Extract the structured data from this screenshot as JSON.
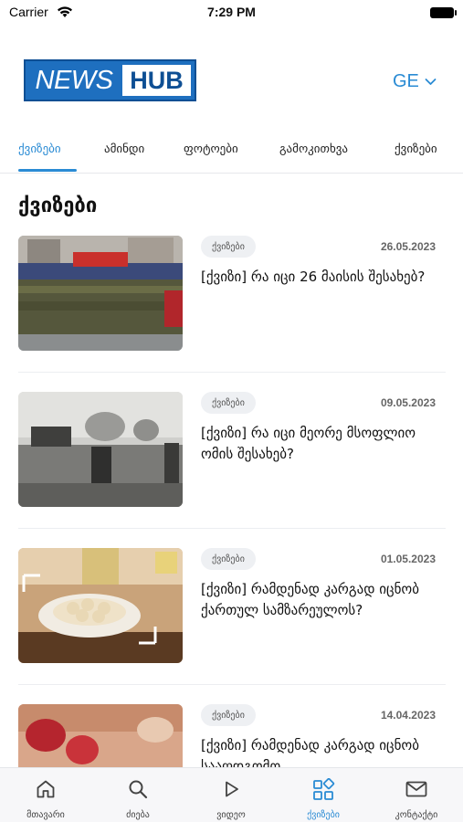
{
  "status_bar": {
    "carrier": "Carrier",
    "time": "7:29 PM"
  },
  "header": {
    "logo_news": "NEWS",
    "logo_hub": "HUB",
    "language": "GE"
  },
  "tabs": [
    {
      "label": "ქვიზები",
      "active": true
    },
    {
      "label": "ამინდი"
    },
    {
      "label": "ფოტოები"
    },
    {
      "label": "გამოკითხვა"
    },
    {
      "label": "ქვიზები"
    }
  ],
  "section_title": "ქვიზები",
  "articles": [
    {
      "category": "ქვიზები",
      "date": "26.05.2023",
      "title": "[ქვიზი] რა იცი 26 მაისის შესახებ?",
      "image": "military-parade-image"
    },
    {
      "category": "ქვიზები",
      "date": "09.05.2023",
      "title": "[ქვიზი] რა იცი მეორე მსოფლიო ომის შესახებ?",
      "image": "ww2-battlefield-image"
    },
    {
      "category": "ქვიზები",
      "date": "01.05.2023",
      "title": "[ქვიზი] რამდენად კარგად იცნობ ქართულ სამზარეულოს?",
      "image": "khinkali-dish-image"
    },
    {
      "category": "ქვიზები",
      "date": "14.04.2023",
      "title": "[ქვიზი] რამდენად კარგად იცნობ სააღდგომო",
      "image": "easter-eggs-image"
    }
  ],
  "bottom_nav": [
    {
      "label": "მთავარი",
      "icon": "home-icon"
    },
    {
      "label": "ძიება",
      "icon": "search-icon"
    },
    {
      "label": "ვიდეო",
      "icon": "play-icon"
    },
    {
      "label": "ქვიზები",
      "icon": "grid-icon",
      "active": true
    },
    {
      "label": "კონტაქტი",
      "icon": "mail-icon"
    }
  ],
  "colors": {
    "accent": "#2a8bd4",
    "logo_blue": "#1e6fbf"
  }
}
